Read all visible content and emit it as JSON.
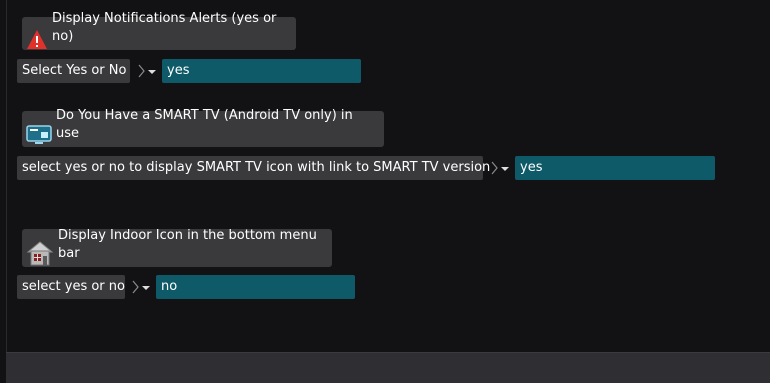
{
  "sections": [
    {
      "icon": "warning-icon",
      "title": "Display Notifications Alerts (yes or no)",
      "prompt": "Select Yes or No",
      "value": "yes"
    },
    {
      "icon": "smart-tv-icon",
      "title": "Do You Have a SMART TV (Android TV only) in use",
      "prompt": "select yes or no to display SMART TV icon with link to SMART TV version",
      "value": "yes"
    },
    {
      "icon": "indoor-house-icon",
      "title": "Display Indoor Icon in the bottom menu bar",
      "prompt": "select yes or no",
      "value": "no"
    }
  ],
  "colors": {
    "background": "#121215",
    "label_bg": "#3a3a3d",
    "field_bg": "#0f5a68",
    "warning": "#e0312b"
  }
}
